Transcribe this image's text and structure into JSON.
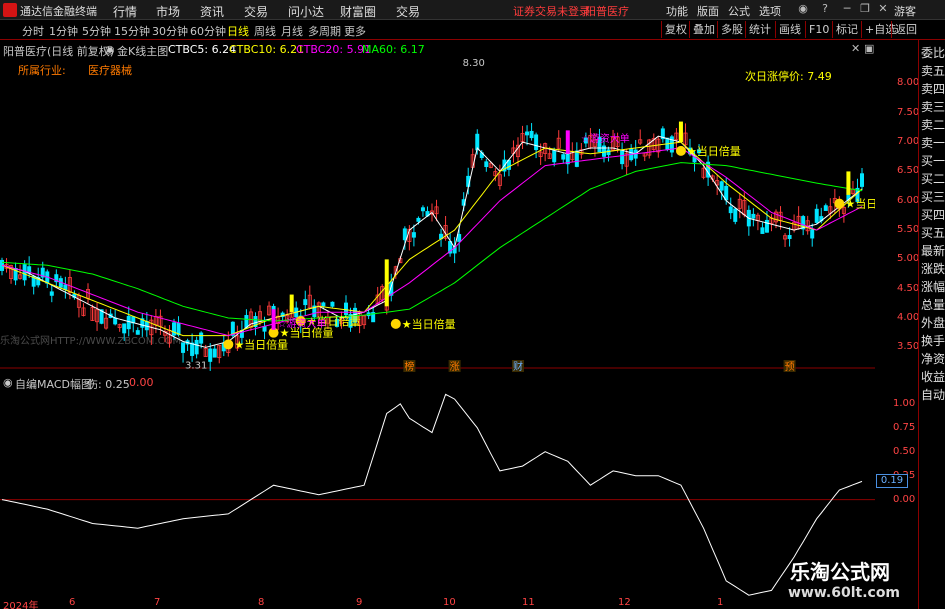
{
  "titlebar": {
    "app_name": "通达信金融终端",
    "menus": [
      "行情",
      "市场",
      "资讯",
      "交易",
      "问小达",
      "财富圈",
      "交易"
    ],
    "security_status": "证券交易未登录",
    "ticker_name": "阳普医疗",
    "right_menus": [
      "功能",
      "版面",
      "公式",
      "选项"
    ],
    "guest": "游客"
  },
  "toolbar": {
    "periods": [
      "分时",
      "1分钟",
      "5分钟",
      "15分钟",
      "30分钟",
      "60分钟",
      "日线",
      "周线",
      "月线",
      "多周期",
      "更多"
    ],
    "active_period": "日线",
    "buttons": [
      "复权",
      "叠加",
      "多股",
      "统计",
      "画线",
      "F10",
      "标记",
      "+自选",
      "返回"
    ]
  },
  "main_header": {
    "stock": "阳普医疗(日线 前复权)",
    "indicator": "金K线主图",
    "ctbc5": "CTBC5: 6.24",
    "ctbc10": "CTBC10: 6.21",
    "ctbc20": "CTBC20: 5.91",
    "ma60": "MA60: 6.17",
    "industry_label": "所属行业:",
    "industry_value": "医疗器械",
    "next_limit": "次日涨停价: 7.49"
  },
  "sub_header": {
    "name": "自编MACD幅图",
    "param": "伤: 0.25",
    "value": "0.00"
  },
  "colors": {
    "up": "#ff3c3c",
    "down": "#00e5ff",
    "ctbc5": "#ffffff",
    "ctbc10": "#ffff00",
    "ctbc20": "#ff00ff",
    "ma60": "#00ff00",
    "frame": "#8b0000"
  },
  "chart_data": [
    {
      "type": "line",
      "series": [
        {
          "name": "CTBC5",
          "x": [
            0,
            5,
            10,
            15,
            20,
            25,
            30,
            35,
            40,
            45,
            50,
            55,
            60,
            65,
            70,
            75,
            80,
            85,
            90,
            95,
            100,
            105,
            110,
            115,
            120,
            125,
            130,
            135,
            140,
            145,
            150,
            155,
            160,
            165,
            170,
            175,
            180,
            185,
            190
          ],
          "values": [
            4.9,
            4.8,
            4.6,
            4.4,
            4.2,
            4.0,
            3.9,
            3.8,
            3.6,
            3.5,
            3.6,
            3.9,
            4.0,
            4.1,
            4.2,
            4.0,
            4.1,
            4.3,
            5.5,
            5.8,
            5.2,
            6.9,
            6.5,
            7.0,
            6.9,
            6.8,
            6.9,
            6.9,
            6.8,
            7.1,
            7.0,
            6.6,
            6.0,
            5.7,
            5.6,
            5.5,
            5.6,
            5.9,
            6.2
          ]
        },
        {
          "name": "CTBC10",
          "x": [
            0,
            10,
            20,
            30,
            40,
            50,
            60,
            70,
            80,
            90,
            100,
            110,
            120,
            130,
            140,
            150,
            160,
            170,
            180,
            190
          ],
          "values": [
            4.9,
            4.6,
            4.3,
            4.0,
            3.7,
            3.7,
            4.0,
            4.2,
            4.1,
            5.0,
            5.5,
            6.5,
            6.9,
            6.8,
            6.9,
            7.0,
            6.3,
            5.7,
            5.5,
            6.2
          ]
        },
        {
          "name": "CTBC20",
          "x": [
            0,
            10,
            20,
            30,
            40,
            50,
            60,
            70,
            80,
            90,
            100,
            110,
            120,
            130,
            140,
            150,
            160,
            170,
            180,
            190
          ],
          "values": [
            4.9,
            4.7,
            4.4,
            4.1,
            3.9,
            3.7,
            3.9,
            4.1,
            4.1,
            4.6,
            5.2,
            6.0,
            6.6,
            6.7,
            6.8,
            6.9,
            6.4,
            5.8,
            5.5,
            5.9
          ]
        },
        {
          "name": "MA60",
          "x": [
            0,
            10,
            20,
            30,
            40,
            50,
            60,
            70,
            80,
            90,
            100,
            110,
            120,
            130,
            140,
            150,
            160,
            170,
            180,
            190
          ],
          "values": [
            4.95,
            4.9,
            4.75,
            4.5,
            4.2,
            4.0,
            3.95,
            4.0,
            4.05,
            4.15,
            4.6,
            5.2,
            5.7,
            6.2,
            6.5,
            6.65,
            6.6,
            6.45,
            6.3,
            6.17
          ]
        }
      ],
      "y_ticks": [
        "8.00",
        "7.50",
        "7.00",
        "6.50",
        "6.00",
        "5.50",
        "5.00",
        "4.50",
        "4.00",
        "3.50"
      ],
      "ylim": [
        3.25,
        8.4
      ],
      "annotations": [
        "8.30",
        "3.31",
        "★当日倍量",
        "☆游资大单",
        "★当日倍"
      ],
      "event_markers": [
        "榜",
        "涨",
        "财",
        "预"
      ]
    },
    {
      "type": "line",
      "series": [
        {
          "name": "自编MACD幅图",
          "x": [
            0,
            10,
            20,
            30,
            40,
            50,
            60,
            70,
            80,
            85,
            88,
            90,
            95,
            98,
            100,
            105,
            110,
            115,
            120,
            125,
            130,
            135,
            140,
            145,
            150,
            155,
            160,
            165,
            170,
            175,
            180,
            185,
            190
          ],
          "values": [
            0.0,
            -0.1,
            -0.25,
            -0.3,
            -0.2,
            -0.15,
            0.15,
            0.05,
            0.15,
            0.9,
            1.0,
            0.85,
            0.7,
            1.1,
            1.05,
            0.75,
            0.3,
            0.35,
            0.5,
            0.4,
            0.15,
            0.3,
            0.25,
            0.25,
            0.15,
            -0.3,
            -0.85,
            -1.0,
            -0.95,
            -0.6,
            -0.2,
            0.1,
            0.19
          ]
        }
      ],
      "y_ticks": [
        "1.00",
        "0.75",
        "0.50",
        "0.25",
        "0.00"
      ],
      "current_value": "0.19",
      "ylim": [
        -1.05,
        1.25
      ]
    }
  ],
  "x_labels": [
    "2024年",
    "6",
    "7",
    "8",
    "9",
    "10",
    "11",
    "12",
    "1"
  ],
  "sidepanel": [
    "委比",
    "卖五",
    "卖四",
    "卖三",
    "卖二",
    "卖一",
    "买一",
    "买二",
    "买三",
    "买四",
    "买五",
    "最新",
    "涨跌",
    "涨幅",
    "总量",
    "外盘",
    "换手",
    "净资",
    "收益",
    "自动"
  ],
  "watermarks": {
    "left": "乐淘公式网HTTP://WWW.ZBCOM.COM",
    "brand": "乐淘公式网",
    "url": "www.60lt.com"
  }
}
